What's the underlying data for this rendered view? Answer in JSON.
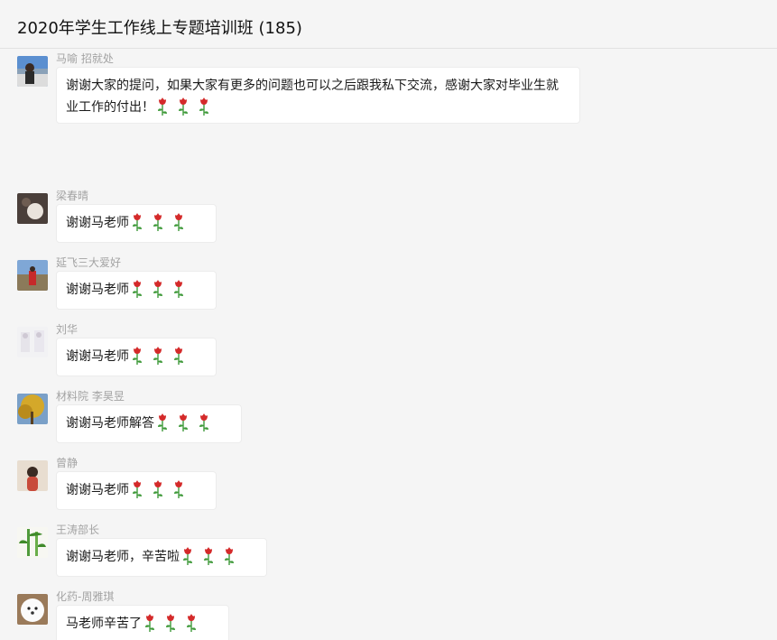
{
  "window": {
    "title": "2020年学生工作线上专题培训班 (185)"
  },
  "icons": {
    "rose": "rose-emoji"
  },
  "colors": {
    "background": "#f5f5f5",
    "bubble": "#ffffff",
    "sender_text": "#a3a3a3",
    "rose_petal": "#d42a2a",
    "rose_stem": "#3f9a3a"
  },
  "messages": [
    {
      "sender": "马喻 招就处",
      "text": "谢谢大家的提问，如果大家有更多的问题也可以之后跟我私下交流，感谢大家对毕业生就业工作的付出！",
      "roses": 3
    },
    {
      "sender": "梁春晴",
      "text": "谢谢马老师",
      "roses": 3
    },
    {
      "sender": "延飞三大爱好",
      "text": "谢谢马老师",
      "roses": 3
    },
    {
      "sender": "刘华",
      "text": "谢谢马老师",
      "roses": 3
    },
    {
      "sender": "材料院 李昊昱",
      "text": "谢谢马老师解答",
      "roses": 3
    },
    {
      "sender": "曾静",
      "text": "谢谢马老师",
      "roses": 3
    },
    {
      "sender": "王涛部长",
      "text": "谢谢马老师，辛苦啦",
      "roses": 3
    },
    {
      "sender": "化药-周雅琪",
      "text": "马老师辛苦了",
      "roses": 3
    }
  ]
}
